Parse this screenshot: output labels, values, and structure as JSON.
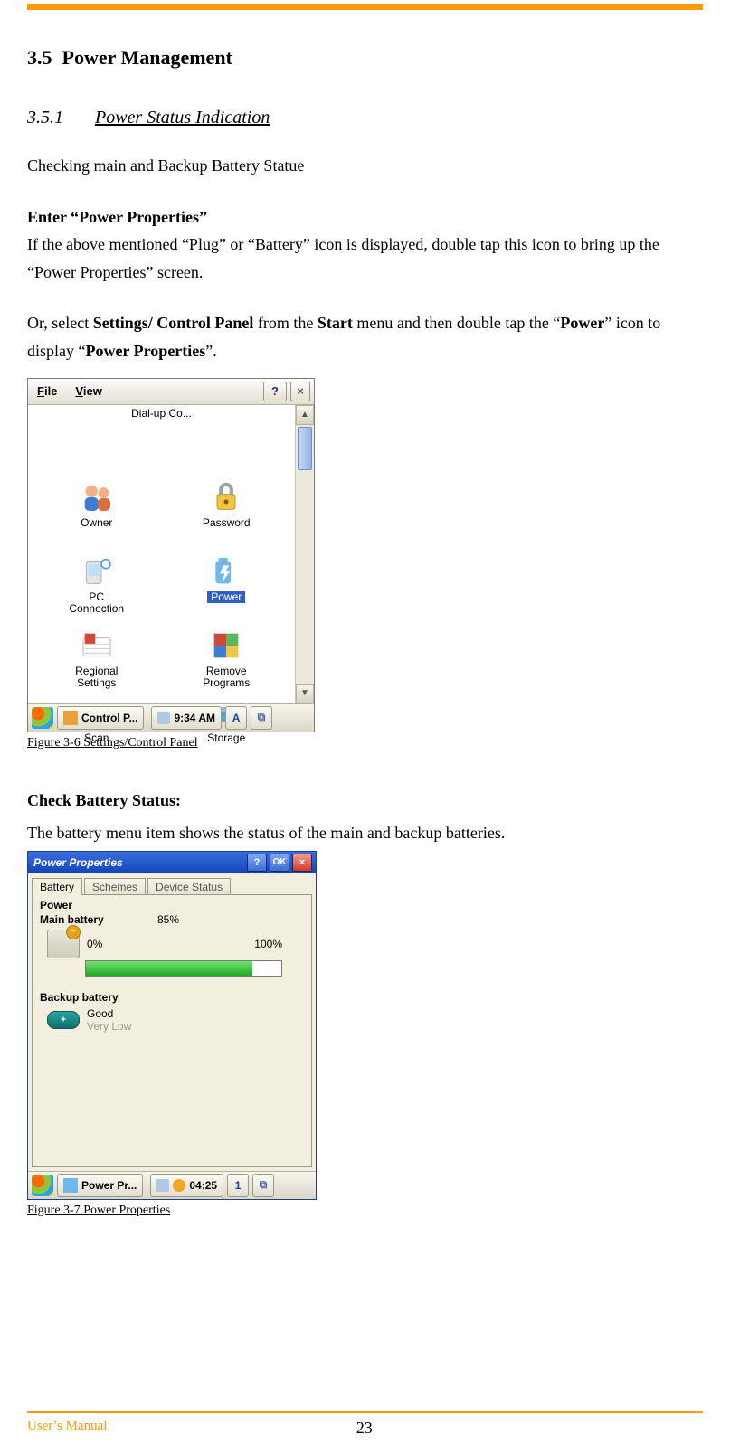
{
  "page": {
    "section_number": "3.5",
    "section_title": "Power Management",
    "subsection_number": "3.5.1",
    "subsection_title": "Power Status Indication",
    "intro": "Checking main and Backup Battery Statue",
    "enter_title": "Enter “Power Properties”",
    "enter_body": "If the above mentioned “Plug” or “Battery” icon is displayed, double tap this icon to bring up the “Power Properties” screen.",
    "or_pre": "Or, select ",
    "or_b1": "Settings/ Control Panel",
    "or_mid1": " from the ",
    "or_b2": "Start",
    "or_mid2": " menu and then double tap the “",
    "or_b3": "Power",
    "or_mid3": "” icon to display “",
    "or_b4": "Power Properties",
    "or_end": "”.",
    "fig1_caption": "Figure 3-6 Settings/Control Panel",
    "check_title": "Check Battery Status:",
    "check_body": "The battery menu item shows the status of the main and backup batteries.",
    "fig2_caption": "Figure 3-7 Power Properties"
  },
  "fig1": {
    "menu_file_pre": "F",
    "menu_file_post": "ile",
    "menu_view_pre": "V",
    "menu_view_post": "iew",
    "help_text": "?",
    "close_text": "×",
    "truncated_row": "Dial-up Co...",
    "items": {
      "owner": "Owner",
      "password": "Password",
      "pc1": "PC",
      "pc2": "Connection",
      "power": "Power",
      "regional1": "Regional",
      "regional2": "Settings",
      "remove1": "Remove",
      "remove2": "Programs",
      "scan": "Scan",
      "storage": "Storage"
    },
    "scroll_up": "▲",
    "scroll_down": "▼",
    "task_title": "Control P...",
    "clock": "9:34 AM",
    "ime": "A",
    "tray": "⧉"
  },
  "fig2": {
    "title": "Power Properties",
    "btn_help": "?",
    "btn_ok": "OK",
    "btn_close": "×",
    "tabs": {
      "battery": "Battery",
      "schemes": "Schemes",
      "device": "Device Status"
    },
    "group_power": "Power",
    "main_label": "Main battery",
    "main_pct": "85%",
    "scale_lo": "0%",
    "scale_hi": "100%",
    "main_fill_pct": 85,
    "backup_label": "Backup battery",
    "backup_good": "Good",
    "backup_low": "Very Low",
    "task_title": "Power Pr...",
    "clock": "04:25",
    "ime": "1",
    "tray": "⧉"
  },
  "footer": {
    "left": "User’s Manual",
    "page": "23"
  }
}
